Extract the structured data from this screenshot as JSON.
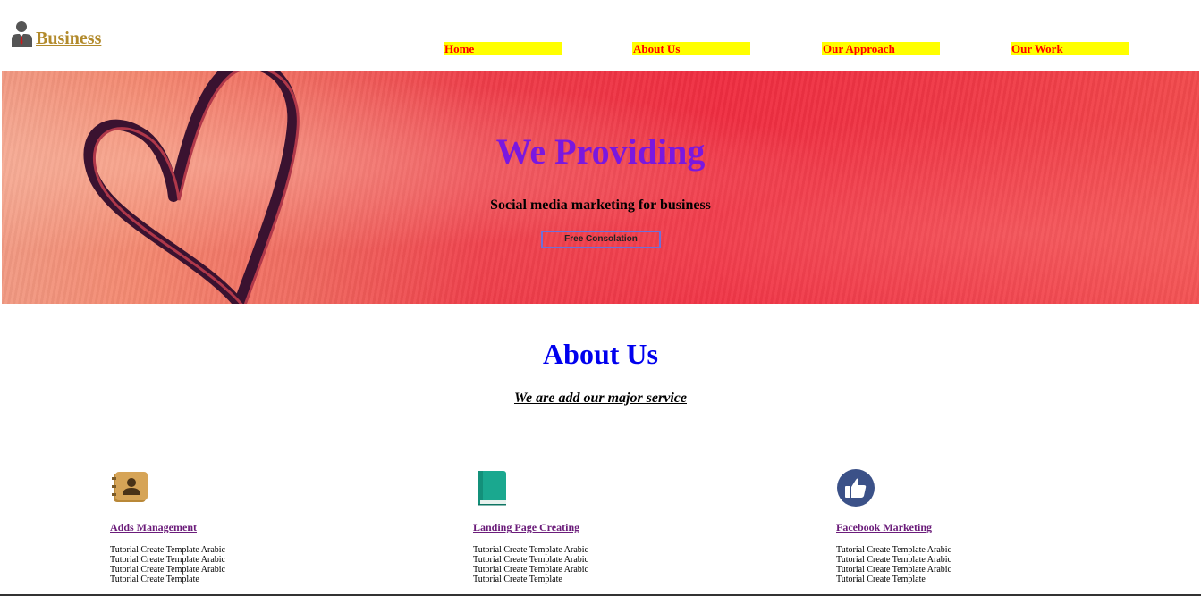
{
  "header": {
    "brand": "Business",
    "brand_color": "#b28a2b",
    "nav": [
      {
        "label": "Home"
      },
      {
        "label": "About Us"
      },
      {
        "label": "Our Approach"
      },
      {
        "label": "Our Work"
      }
    ],
    "nav_bg": "#ffff00",
    "nav_color": "#ff0000"
  },
  "hero": {
    "title": "We Providing",
    "subtitle": "Social media marketing for business",
    "cta": "Free Consolation",
    "title_color": "#7a17e0"
  },
  "about": {
    "title": "About Us",
    "subtitle": "We are add our major service",
    "title_color": "#0000ee"
  },
  "services": [
    {
      "icon": "address-book-icon",
      "title": "Adds Management",
      "lines": [
        "Tutorial Create Template Arabic",
        "Tutorial Create Template Arabic",
        "Tutorial Create Template Arabic",
        "Tutorial Create Template"
      ]
    },
    {
      "icon": "book-icon",
      "title": "Landing Page Creating",
      "lines": [
        "Tutorial Create Template Arabic",
        "Tutorial Create Template Arabic",
        "Tutorial Create Template Arabic",
        "Tutorial Create Template"
      ]
    },
    {
      "icon": "thumbs-up-icon",
      "title": "Facebook Marketing",
      "lines": [
        "Tutorial Create Template Arabic",
        "Tutorial Create Template Arabic",
        "Tutorial Create Template Arabic",
        "Tutorial Create Template"
      ]
    }
  ]
}
